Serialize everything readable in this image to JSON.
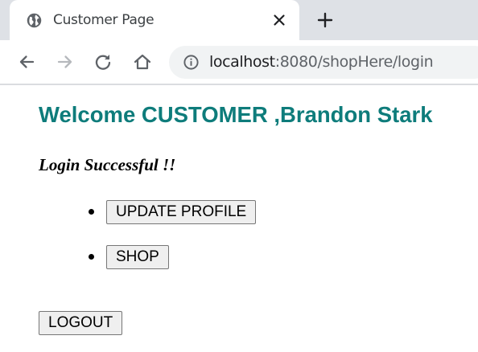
{
  "browser": {
    "tab_title": "Customer Page",
    "url_host": "localhost",
    "url_rest": ":8080/shopHere/login"
  },
  "page": {
    "heading": "Welcome CUSTOMER ,Brandon Stark",
    "status_message": "Login Successful !!",
    "menu": [
      {
        "label": "UPDATE PROFILE"
      },
      {
        "label": "SHOP"
      }
    ],
    "logout_label": "LOGOUT"
  },
  "colors": {
    "heading": "#0e7c7b",
    "tabstrip": "#dee1e6",
    "omnibox": "#f1f3f4"
  },
  "icons": {
    "tab": "globe-icon",
    "close": "close-icon",
    "new_tab": "plus-icon",
    "back": "back-arrow-icon",
    "forward": "forward-arrow-icon",
    "reload": "reload-icon",
    "home": "home-icon",
    "site_info": "info-icon"
  }
}
